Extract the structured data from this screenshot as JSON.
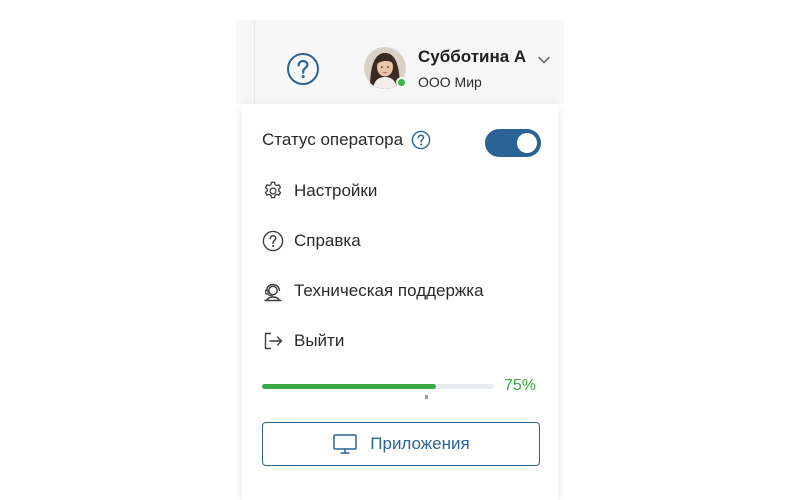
{
  "header": {
    "user_name": "Субботина А",
    "user_org": "ООО Мир",
    "help_icon": "question-circle-icon",
    "chevron_icon": "chevron-down-icon",
    "online_status_color": "#3bb54a"
  },
  "menu": {
    "operator_status": {
      "label": "Статус оператора",
      "help_icon": "question-circle-icon",
      "enabled": true,
      "toggle_color": "#2a6496"
    },
    "items": [
      {
        "label": "Настройки",
        "icon": "gear-icon"
      },
      {
        "label": "Справка",
        "icon": "question-circle-icon"
      },
      {
        "label": "Техническая поддержка",
        "icon": "headset-icon"
      },
      {
        "label": "Выйти",
        "icon": "logout-icon"
      }
    ],
    "progress": {
      "value": 0.75,
      "label": "75%",
      "color": "#3aa946"
    },
    "apps_button": {
      "label": "Приложения",
      "icon": "monitor-icon",
      "color": "#2a6496"
    }
  }
}
